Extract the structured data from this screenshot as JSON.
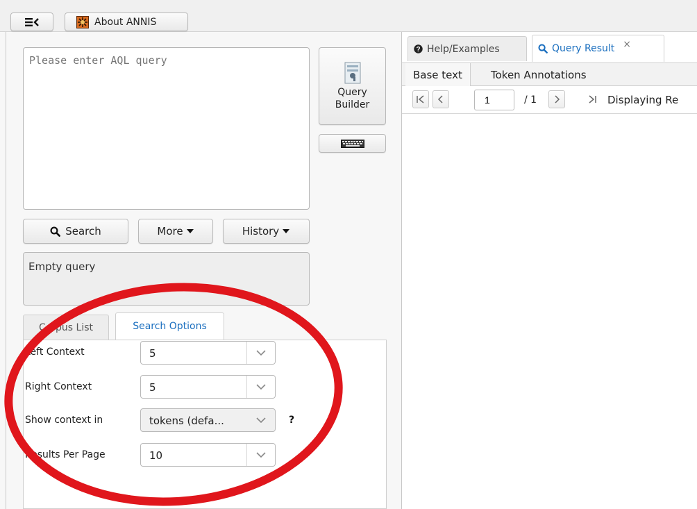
{
  "topbar": {
    "about_label": "About ANNIS"
  },
  "query": {
    "placeholder": "Please enter AQL query",
    "builder_label_line1": "Query",
    "builder_label_line2": "Builder"
  },
  "actions": {
    "search_label": "Search",
    "more_label": "More",
    "history_label": "History"
  },
  "status": {
    "message": "Empty query"
  },
  "left_tabs": {
    "corpus_list": "Corpus List",
    "search_options": "Search Options"
  },
  "options": {
    "left_context": {
      "label": "Left Context",
      "value": "5"
    },
    "right_context": {
      "label": "Right Context",
      "value": "5"
    },
    "show_context_in": {
      "label": "Show context in",
      "value": "tokens (defa...",
      "help": "?"
    },
    "results_per_page": {
      "label": "Results Per Page",
      "value": "10"
    }
  },
  "right_tabs": {
    "help_label": "Help/Examples",
    "result_label": "Query Result",
    "close_glyph": "×"
  },
  "subtabs": {
    "base_text": "Base text",
    "token_annotations": "Token Annotations"
  },
  "pager": {
    "page_value": "1",
    "total": "/ 1",
    "displaying": "Displaying Re"
  },
  "colors": {
    "accent": "#1b6fbf",
    "annotation_red": "#e0161c"
  },
  "annotation_shape": "red-ellipse"
}
